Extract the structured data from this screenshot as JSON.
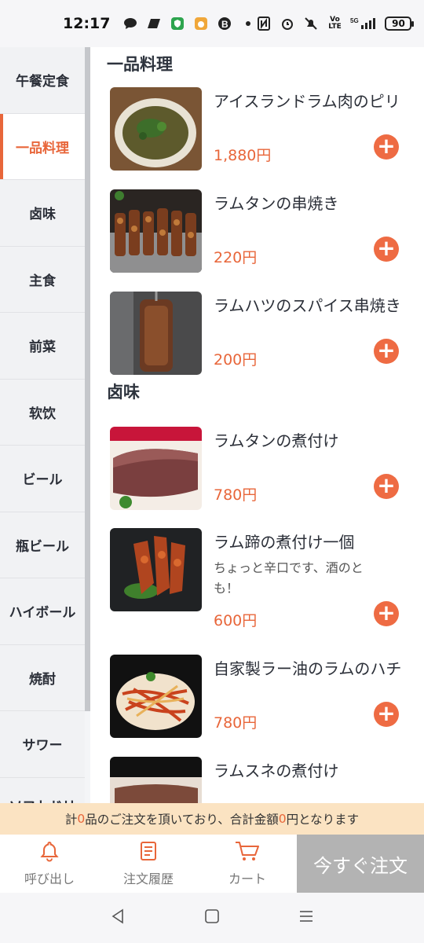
{
  "status_bar": {
    "time": "12:17",
    "battery": "90",
    "network": "5G"
  },
  "sidebar": {
    "items": [
      {
        "label": "午餐定食"
      },
      {
        "label": "一品料理"
      },
      {
        "label": "卤味"
      },
      {
        "label": "主食"
      },
      {
        "label": "前菜"
      },
      {
        "label": "软饮"
      },
      {
        "label": "ビール"
      },
      {
        "label": "瓶ビール"
      },
      {
        "label": "ハイボール"
      },
      {
        "label": "焼酎"
      },
      {
        "label": "サワー"
      },
      {
        "label": "ソフトドリ"
      }
    ],
    "active_index": 1
  },
  "sections": [
    {
      "title": "一品料理",
      "items": [
        {
          "name": "アイスランドラム肉のピリ",
          "price": "1,880円"
        },
        {
          "name": "ラムタンの串焼き",
          "price": "220円"
        },
        {
          "name": "ラムハツのスパイス串焼き",
          "price": "200円"
        }
      ]
    },
    {
      "title": "卤味",
      "items": [
        {
          "name": "ラムタンの煮付け",
          "price": "780円"
        },
        {
          "name": "ラム蹄の煮付け一個",
          "description": "ちょっと辛口です、酒のとも！",
          "price": "600円"
        },
        {
          "name": "自家製ラー油のラムのハチ",
          "price": "780円"
        },
        {
          "name": "ラムスネの煮付け",
          "price": ""
        }
      ]
    }
  ],
  "summary": {
    "prefix": "計",
    "count": "0",
    "middle": "品のご注文を頂いており、合計金額",
    "amount": "0",
    "suffix": "円となります"
  },
  "bottom_nav": {
    "call_label": "呼び出し",
    "history_label": "注文履歴",
    "cart_label": "カート",
    "order_label": "今すぐ注文"
  },
  "colors": {
    "accent": "#e8663a",
    "summary_bg": "#fbe3c2",
    "order_button_bg": "#b3b3b3"
  }
}
